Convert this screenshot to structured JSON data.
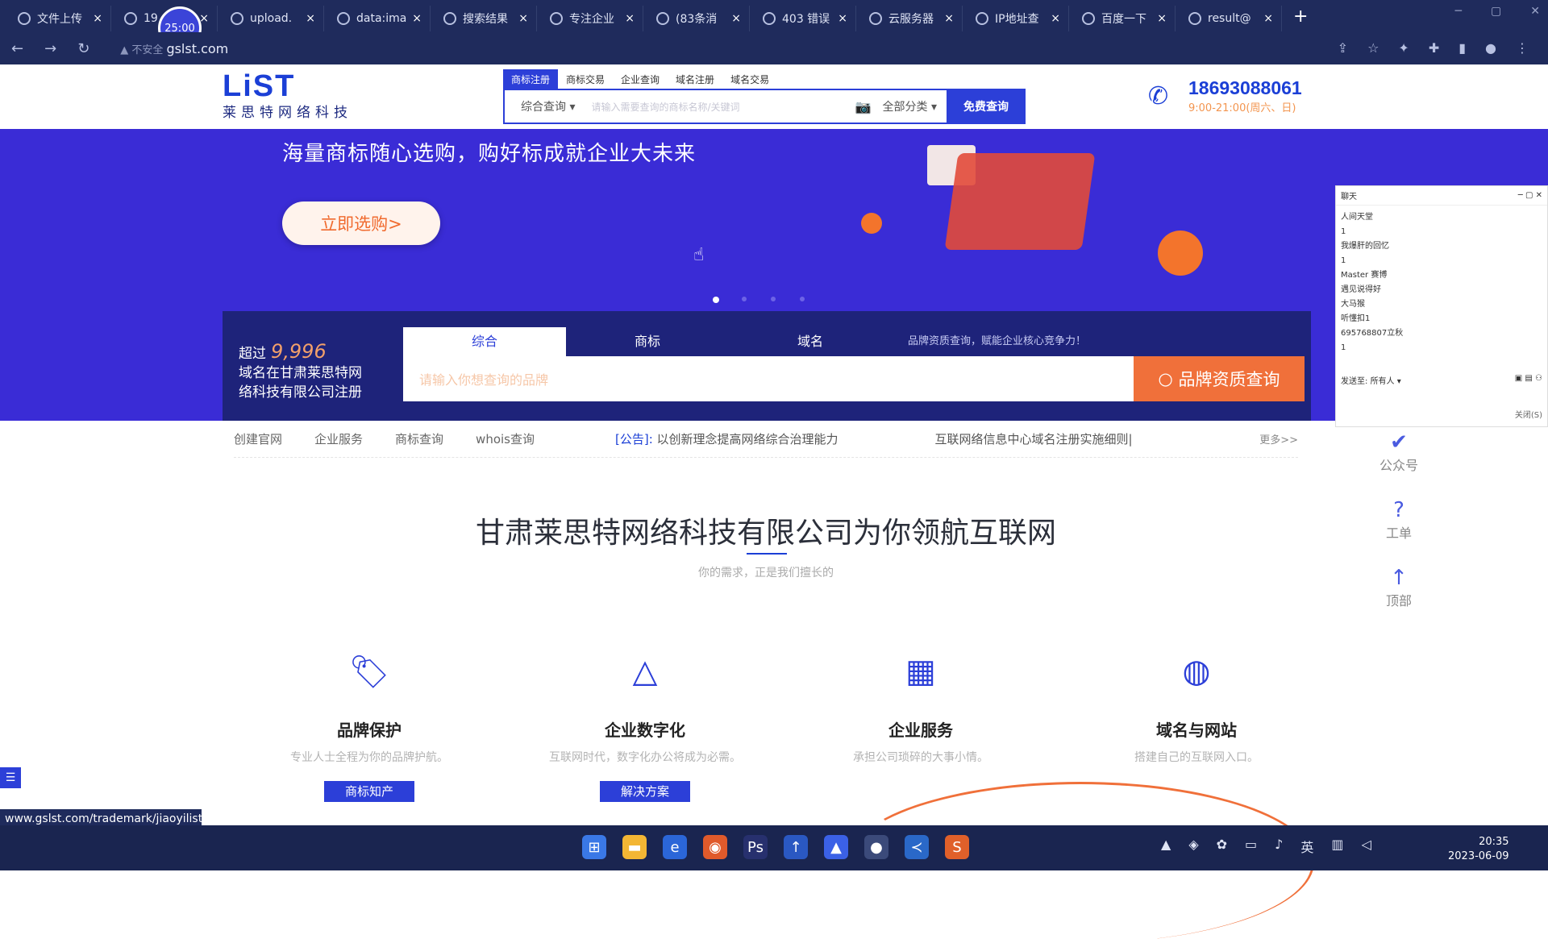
{
  "browser": {
    "tabs": [
      {
        "label": "文件上传",
        "icon": "globe-icon"
      },
      {
        "label": "19",
        "icon": "globe-icon"
      },
      {
        "label": "upload.",
        "icon": "globe-icon"
      },
      {
        "label": "data:ima",
        "icon": "globe-icon"
      },
      {
        "label": "搜索结果",
        "icon": "search-icon"
      },
      {
        "label": "专注企业",
        "icon": "heart-icon"
      },
      {
        "label": "(83条消",
        "icon": "c-icon"
      },
      {
        "label": "403 错误",
        "icon": "globe-icon"
      },
      {
        "label": "云服务器",
        "icon": "cloud-icon"
      },
      {
        "label": "IP地址查",
        "icon": "globe-icon"
      },
      {
        "label": "百度一下",
        "icon": "baidu-icon"
      },
      {
        "label": "result@",
        "icon": "globe-icon"
      }
    ],
    "tab_close": "×",
    "new_tab": "+",
    "address": {
      "security": "不安全",
      "url": "gslst.com"
    },
    "recording_badge": "25:00",
    "status_url": "www.gslst.com/trademark/jiaoyilists"
  },
  "header": {
    "logo_mark": "LiST",
    "logo_name": "莱思特网络科技",
    "search_tabs": [
      "商标注册",
      "商标交易",
      "企业查询",
      "域名注册",
      "域名交易"
    ],
    "search_select": "综合查询",
    "search_placeholder": "请输入需要查询的商标名称/关键词",
    "search_category": "全部分类",
    "search_button": "免费查询",
    "phone": "18693088061",
    "hours": "9:00-21:00(周六、日)"
  },
  "banner": {
    "slogan": "海量商标随心选购，购好标成就企业大未来",
    "buy_button": "立即选购>",
    "stat_prefix": "超过",
    "stat_number": "9,996",
    "stat_line2": "域名在甘肃莱思特网",
    "stat_line3": "络科技有限公司注册",
    "query_tabs": [
      "综合",
      "商标",
      "域名"
    ],
    "query_note": "品牌资质查询，赋能企业核心竞争力！",
    "query_placeholder": "请输入你想查询的品牌",
    "query_button": "品牌资质查询"
  },
  "subnav": {
    "links": [
      "创建官网",
      "企业服务",
      "商标查询",
      "whois查询"
    ],
    "announcement_label": "[公告]:",
    "announcement": "以创新理念提高网络综合治理能力",
    "announcement2": "互联网络信息中心域名注册实施细则|",
    "more": "更多>>"
  },
  "main": {
    "title": "甘肃莱思特网络科技有限公司为你领航互联网",
    "subtitle": "你的需求，正是我们擅长的",
    "features": [
      {
        "icon": "tag-icon",
        "glyph": "🏷",
        "title": "品牌保护",
        "desc": "专业人士全程为你的品牌护航。",
        "button": "商标知产"
      },
      {
        "icon": "triangle-icon",
        "glyph": "△",
        "title": "企业数字化",
        "desc": "互联网时代，数字化办公将成为必需。",
        "button": "解决方案"
      },
      {
        "icon": "building-icon",
        "glyph": "▦",
        "title": "企业服务",
        "desc": "承担公司琐碎的大事小情。",
        "button": ""
      },
      {
        "icon": "globe-icon",
        "glyph": "◍",
        "title": "域名与网站",
        "desc": "搭建自己的互联网入口。",
        "button": ""
      }
    ]
  },
  "chat": {
    "title": "聊天",
    "messages": [
      "人间天堂",
      "1",
      "我爆肝的回忆",
      "1",
      "Master 赛博",
      "遇见说得好",
      "大马猴",
      "听懂扣1",
      "695768807立秋",
      "1"
    ],
    "send_to_label": "发送至:",
    "send_to": "所有人",
    "close": "关闭(S)"
  },
  "side_float": [
    "公众号",
    "工单",
    "顶部"
  ],
  "taskbar": {
    "time": "20:35",
    "date": "2023-06-09",
    "ime": "英"
  }
}
